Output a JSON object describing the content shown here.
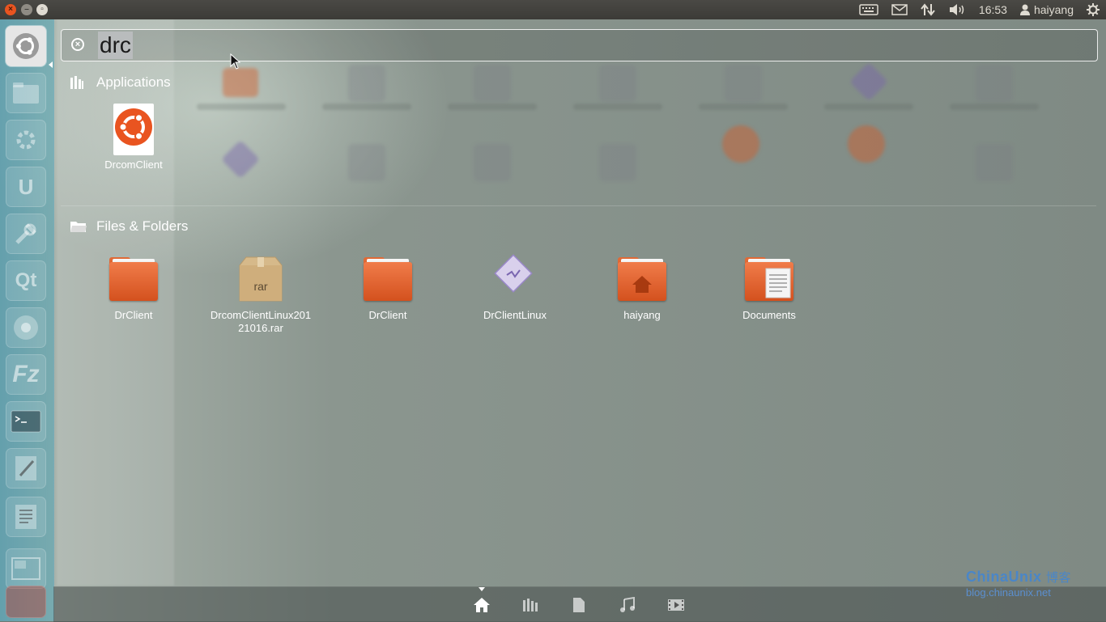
{
  "top_panel": {
    "clock": "16:53",
    "user": "haiyang",
    "indicators": [
      "keyboard-icon",
      "mail-icon",
      "network-icon",
      "volume-icon",
      "clock",
      "user-icon",
      "session-gear-icon"
    ]
  },
  "launcher": {
    "items": [
      "ubuntu-dash-icon",
      "files-icon",
      "settings-icon",
      "ubuntu-one-icon",
      "system-settings-icon",
      "qt-creator-icon",
      "chromium-icon",
      "filezilla-icon",
      "terminal-icon",
      "text-editor-icon",
      "document-viewer-icon",
      "workspace-switcher-icon",
      "trash-icon"
    ],
    "labels": {
      "qt": "Qt",
      "fz": "Fz",
      "ubuntu_one": "U"
    }
  },
  "search": {
    "query": "drc"
  },
  "categories": {
    "applications": {
      "title": "Applications",
      "items": [
        {
          "label": "DrcomClient",
          "icon": "ubuntu-app-icon"
        }
      ]
    },
    "files": {
      "title": "Files & Folders",
      "items": [
        {
          "label": "DrClient",
          "icon": "folder-icon"
        },
        {
          "label": "DrcomClientLinux20121016.rar",
          "label_line1": "DrcomClientLinux201",
          "label_line2": "21016.rar",
          "icon": "rar-archive-icon",
          "badge": "rar"
        },
        {
          "label": "DrClient",
          "icon": "folder-icon"
        },
        {
          "label": "DrClientLinux",
          "icon": "executable-icon"
        },
        {
          "label": "haiyang",
          "icon": "home-folder-icon"
        },
        {
          "label": "Documents",
          "icon": "documents-folder-icon"
        }
      ]
    }
  },
  "dock": {
    "lenses": [
      "home-lens-icon",
      "applications-lens-icon",
      "files-lens-icon",
      "music-lens-icon",
      "video-lens-icon"
    ],
    "active": "home-lens-icon"
  },
  "watermark": {
    "brand": "ChinaUnix",
    "suffix": "博客",
    "url": "blog.chinaunix.net"
  },
  "colors": {
    "ubuntu_orange": "#e95420",
    "panel": "#3c3b37",
    "launcher": "#2a8fa8"
  }
}
